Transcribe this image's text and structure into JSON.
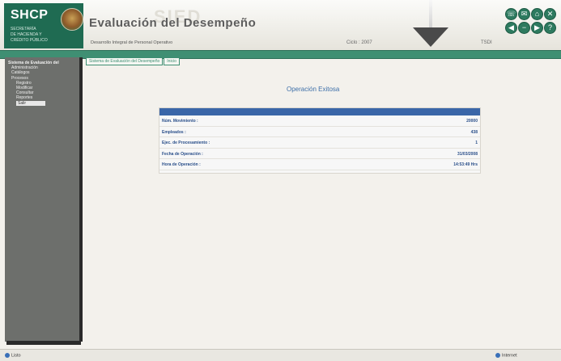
{
  "header": {
    "logo": "SHCP",
    "logo_sub": [
      "SECRETARÍA",
      "DE HACIENDA Y",
      "CRÉDITO PÚBLICO"
    ],
    "app_title": "Evaluación del Desempeño",
    "ghost_title": "SIED",
    "subtitle": "Desarrollo Integral de Personal Operativo",
    "cycle": "Ciclo : 2007",
    "user_code": "TSDI"
  },
  "toolbar_icons": [
    "phone-icon",
    "mail-icon",
    "home-icon",
    "close-icon",
    "back-icon",
    "minus-icon",
    "help-icon",
    "next-icon"
  ],
  "sidebar": {
    "items": [
      {
        "label": "Sistema de Evaluación del",
        "level": "root"
      },
      {
        "label": "Administración",
        "level": "l1"
      },
      {
        "label": "Catálogos",
        "level": "l1"
      },
      {
        "label": "Procesos",
        "level": "l1"
      },
      {
        "label": "Registro",
        "level": "l2"
      },
      {
        "label": "Modificar",
        "level": "l2"
      },
      {
        "label": "Consultar",
        "level": "l2"
      },
      {
        "label": "Reportes",
        "level": "l2"
      },
      {
        "label": "Salir",
        "level": "selected"
      }
    ]
  },
  "tabs": [
    "Sistema de Evaluación del Desempeño",
    "Inicio"
  ],
  "page_title": "Operación Exitosa",
  "result": {
    "rows": [
      {
        "label": "Núm. Movimiento :",
        "value": "20000"
      },
      {
        "label": "Empleados :",
        "value": "438"
      },
      {
        "label": "Ejec. de Procesamiento :",
        "value": "1"
      },
      {
        "label": "Fecha de Operación :",
        "value": "31/03/2008"
      },
      {
        "label": "Hora de Operación :",
        "value": "14:53:49 Hrs"
      }
    ]
  },
  "status": {
    "left": "Listo",
    "right": "Internet"
  },
  "colors": {
    "brand_green": "#1f6b52",
    "accent_blue": "#3a66a8"
  }
}
